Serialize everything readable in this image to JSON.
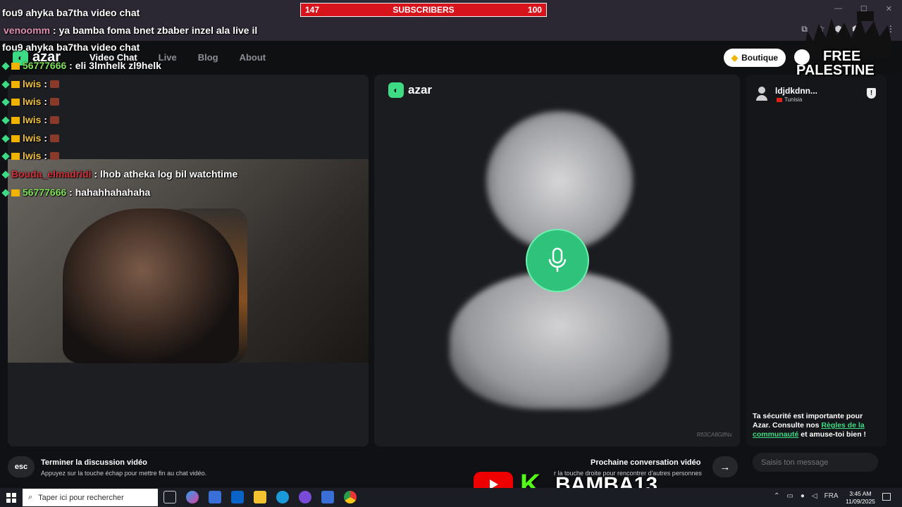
{
  "subscribers": {
    "current": "147",
    "label": "SUBSCRIBERS",
    "goal": "100"
  },
  "chat": [
    {
      "user": "",
      "text": "fou9 ahyka ba7tha video chat"
    },
    {
      "user": "venoomm",
      "sep": " : ",
      "text": "ya bamba foma bnet zbaber inzel ala live il"
    },
    {
      "user": "",
      "text": "fou9 ahyka ba7tha video chat"
    },
    {
      "user": "56777666",
      "sep": " : ",
      "text": "eli 3lmhelk zl9helk"
    },
    {
      "user": "lwis",
      "sep": " : ",
      "text": ""
    },
    {
      "user": "lwis",
      "sep": " : ",
      "text": ""
    },
    {
      "user": "lwis",
      "sep": " : ",
      "text": ""
    },
    {
      "user": "lwis",
      "sep": " : ",
      "text": ""
    },
    {
      "user": "lwis",
      "sep": " : ",
      "text": ""
    },
    {
      "user": "Bouda_elmadridi",
      "sep": " : ",
      "text": "lhob atheka log bil watchtime"
    },
    {
      "user": "56777666",
      "sep": " : ",
      "text": "hahahhahahaha"
    }
  ],
  "header": {
    "logo": "azar",
    "nav": [
      "Video Chat",
      "Live",
      "Blog",
      "About"
    ],
    "boutique": "Boutique"
  },
  "overlay": {
    "free": "FREE",
    "palestine": "PALESTINE",
    "channel": "BAMBA13",
    "kick": "K"
  },
  "video": {
    "logo": "azar",
    "uid": "Rfi3CA8GlfNx"
  },
  "peer": {
    "name": "ldjdkdnn...",
    "country": "Tunisia"
  },
  "safety": {
    "pre": "Ta sécurité est importante pour Azar. Consulte nos ",
    "link": "Règles de la communauté",
    "post": " et amuse-toi bien !"
  },
  "message_placeholder": "Saisis ton message",
  "controls": {
    "esc": "esc",
    "end_title": "Terminer la discussion vidéo",
    "end_sub": "Appuyez sur la touche échap pour mettre fin au chat vidéo.",
    "next_title": "Prochaine conversation vidéo",
    "next_sub": "r la touche droite pour rencontrer d'autres personnes"
  },
  "taskbar": {
    "search_placeholder": "Taper ici pour rechercher",
    "lang": "FRA",
    "time": "3:45 AM",
    "date": "11/09/2025"
  },
  "colors": {
    "accent": "#3ddc84",
    "subbar": "#d7141c",
    "youtube": "#ee0000",
    "kick": "#53fc18"
  }
}
